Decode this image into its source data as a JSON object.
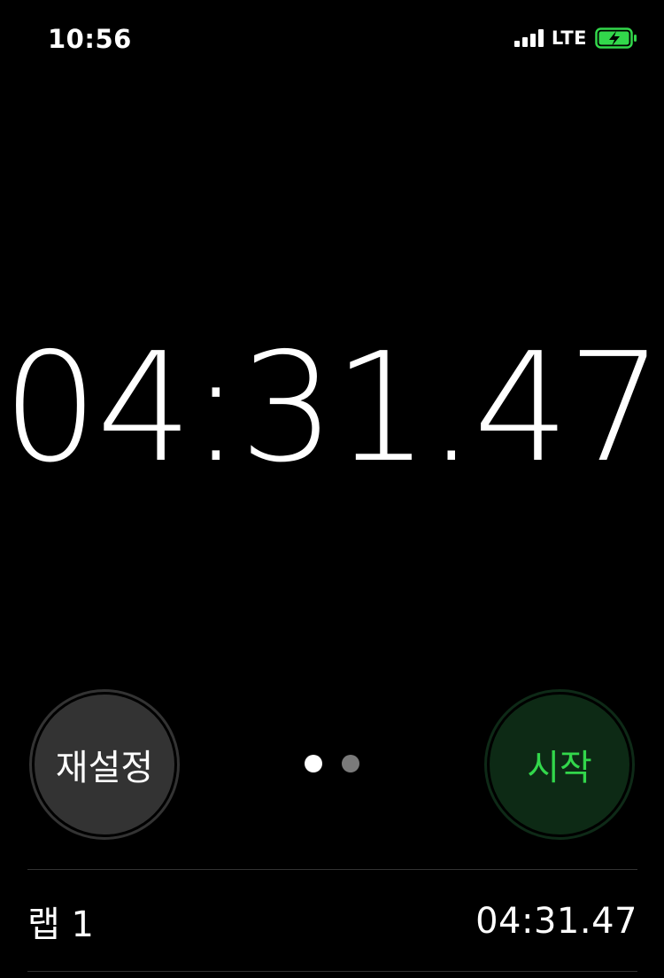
{
  "status_bar": {
    "time": "10:56",
    "network": "LTE",
    "icons": [
      "signal-icon",
      "battery-charging-icon"
    ],
    "battery_color": "#32d74b"
  },
  "stopwatch": {
    "display": "04:31.47"
  },
  "controls": {
    "reset_label": "재설정",
    "start_label": "시작",
    "start_color": "#32d74b"
  },
  "pager": {
    "dots": [
      {
        "active": true,
        "color": "#ffffff"
      },
      {
        "active": false,
        "color": "#7a7a7a"
      }
    ]
  },
  "laps": [
    {
      "label": "랩 1",
      "time": "04:31.47"
    }
  ]
}
